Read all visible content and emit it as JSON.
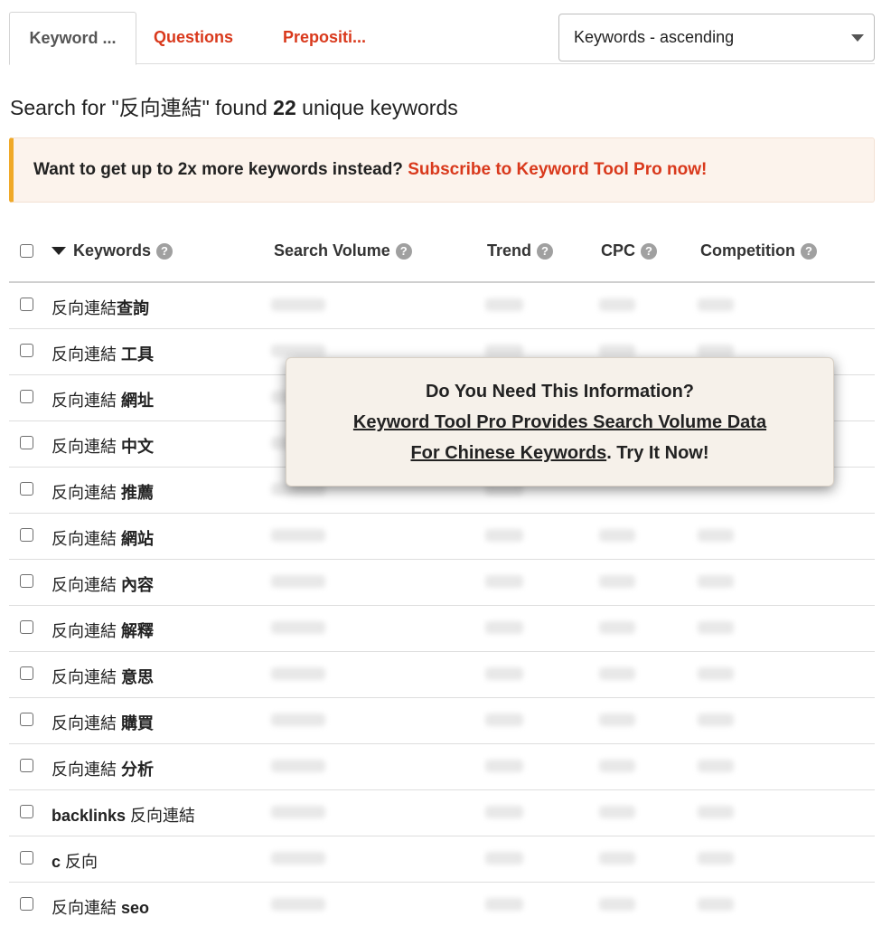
{
  "tabs": [
    {
      "label": "Keyword ..."
    },
    {
      "label": "Questions"
    },
    {
      "label": "Prepositi..."
    }
  ],
  "sort_select": {
    "value": "Keywords - ascending"
  },
  "summary": {
    "prefix": "Search for \"反向連結\" found ",
    "count": "22",
    "suffix": " unique keywords"
  },
  "promo": {
    "text": "Want to get up to 2x more keywords instead? ",
    "link": "Subscribe to Keyword Tool Pro now!"
  },
  "table": {
    "columns": {
      "keywords": "Keywords",
      "search_volume": "Search Volume",
      "trend": "Trend",
      "cpc": "CPC",
      "competition": "Competition"
    },
    "rows": [
      {
        "base": "反向連結",
        "extra": "查詢"
      },
      {
        "base": "反向連結 ",
        "extra": "工具"
      },
      {
        "base": "反向連結 ",
        "extra": "網址"
      },
      {
        "base": "反向連結 ",
        "extra": "中文"
      },
      {
        "base": "反向連結 ",
        "extra": "推薦"
      },
      {
        "base": "反向連結 ",
        "extra": "網站"
      },
      {
        "base": "反向連結 ",
        "extra": "內容"
      },
      {
        "base": "反向連結 ",
        "extra": "解釋"
      },
      {
        "base": "反向連結 ",
        "extra": "意思"
      },
      {
        "base": "反向連結 ",
        "extra": "購買"
      },
      {
        "base": "反向連結 ",
        "extra": "分析"
      },
      {
        "bold_first": "backlinks",
        "rest": " 反向連結"
      },
      {
        "bold_first": "c",
        "rest": " 反向"
      },
      {
        "base": "反向連結 ",
        "extra": "seo"
      }
    ]
  },
  "overlay": {
    "line1": "Do You Need This Information?",
    "line2_link": "Keyword Tool Pro Provides Search Volume Data",
    "line3_link": "For Chinese Keywords",
    "line3_rest": ". Try It Now!"
  },
  "colors": {
    "accent_red": "#d9391c",
    "promo_border": "#f0a928",
    "promo_bg": "#fcf3ec",
    "overlay_bg": "#f6f1ea"
  },
  "icons": {
    "help": "question-circle-icon",
    "sort": "sort-desc-triangle-icon",
    "dropdown": "chevron-down-icon"
  }
}
